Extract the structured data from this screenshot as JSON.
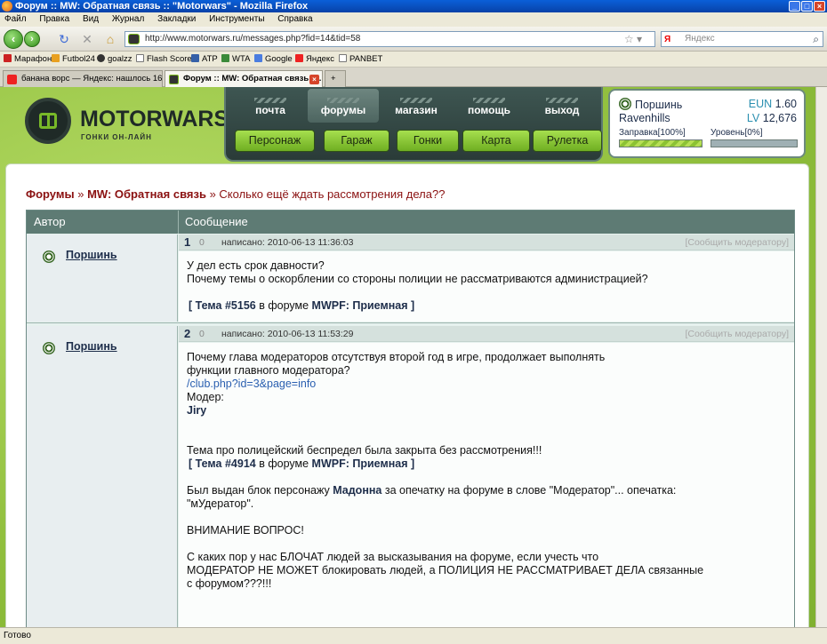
{
  "window": {
    "title": "Форум :: MW: Обратная связь :: \"Motorwars\" - Mozilla Firefox"
  },
  "menu": [
    "Файл",
    "Правка",
    "Вид",
    "Журнал",
    "Закладки",
    "Инструменты",
    "Справка"
  ],
  "address": {
    "url": "http://www.motorwars.ru/messages.php?fid=14&tid=58"
  },
  "search": {
    "placeholder": "Яндекс",
    "engine_label": "Я"
  },
  "bookmarks": [
    "Марафон",
    "Futbol24",
    "goalzz",
    "Flash Score",
    "ATP",
    "WTA",
    "Google",
    "Яндекс",
    "PANBET"
  ],
  "tabs": [
    {
      "label": "банана ворс — Яндекс: нашлось 169 ...",
      "active": false
    },
    {
      "label": "Форум :: MW: Обратная связь :: ...",
      "active": true
    }
  ],
  "site": {
    "logo_text": "MOTORWARS.RU",
    "logo_sub": "ГОНКИ ОН-ЛАЙН",
    "top_nav": [
      "почта",
      "форумы",
      "магазин",
      "помощь",
      "выход"
    ],
    "sub_nav": [
      "Персонаж",
      "Гараж",
      "Гонки",
      "Карта",
      "Рулетка"
    ],
    "user": {
      "name": "Поршинь",
      "city": "Ravenhills",
      "eun_label": "EUN",
      "eun_value": "1.60",
      "lv_label": "LV",
      "lv_value": "12,676",
      "fuel_label": "Заправка[100%]",
      "level_label": "Уровень[0%]",
      "fuel_pct": 100,
      "level_pct": 0
    }
  },
  "breadcrumb": {
    "forums": "Форумы",
    "sep1": "»",
    "section": "MW: Обратная связь",
    "sep2": "»",
    "topic": "Сколько ещё ждать рассмотрения дела??"
  },
  "table": {
    "col_author": "Автор",
    "col_message": "Сообщение"
  },
  "posts": [
    {
      "num": "1",
      "rating": "0",
      "date": "написано: 2010-06-13 11:36:03",
      "report": "[Сообщить модератору]",
      "author": "Поршинь",
      "line1": "У дел есть срок давности?",
      "line2": "Почему темы о оскорблении со стороны полиции не рассматриваются администрацией?",
      "ref_open": "[ Тема",
      "ref_num": "#5156",
      "ref_mid": "в форуме",
      "ref_forum": "MWPF: Приемная",
      "ref_close": "]"
    },
    {
      "num": "2",
      "rating": "0",
      "date": "написано: 2010-06-13 11:53:29",
      "report": "[Сообщить модератору]",
      "author": "Поршинь",
      "l1": "Почему глава модераторов отсутствуя второй год в игре, продолжает выполнять",
      "l2": "функции главного модератора?",
      "l3": "/club.php?id=3&page=info",
      "l4": "Модер:",
      "l5": "Jiry",
      "l6": "Тема про полицейский беспредел была закрыта без рассмотрения!!!",
      "ref_open": "[ Тема",
      "ref_num": "#4914",
      "ref_mid": "в форуме",
      "ref_forum": "MWPF: Приемная",
      "ref_close": "]",
      "l7a": "Был выдан блок персонажу",
      "l7b": "Мадонна",
      "l7c": "за опечатку на форуме в слове \"Модератор\"... опечатка:",
      "l8": "\"мУдератор\".",
      "l9": "ВНИМАНИЕ ВОПРОС!",
      "l10": "С каких пор у нас БЛОЧАТ людей за высказывания на форуме, если учесть что",
      "l11": "МОДЕРАТОР НЕ МОЖЕТ блокировать людей, а ПОЛИЦИЯ НЕ РАССМАТРИВАЕТ ДЕЛА связанные",
      "l12": "с форумом???!!!"
    }
  ],
  "status": {
    "text": "Готово"
  }
}
